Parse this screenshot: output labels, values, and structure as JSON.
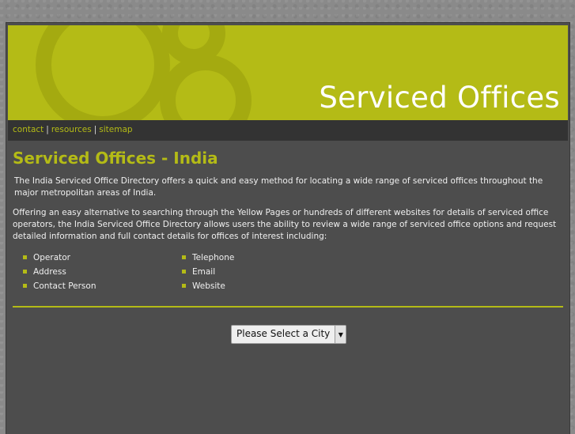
{
  "header": {
    "title": "Serviced Offices",
    "colors": {
      "accent": "#b4bb16",
      "panel": "#4d4d4d",
      "nav": "#333333"
    }
  },
  "nav": {
    "links": [
      {
        "label": "contact"
      },
      {
        "label": "resources"
      },
      {
        "label": "sitemap"
      }
    ],
    "separator": "|"
  },
  "main": {
    "heading": "Serviced Offices - India",
    "intro": "The India Serviced Office Directory offers a quick and easy method for locating a wide range of serviced offices throughout the major metropolitan areas of India.",
    "body": "Offering an easy alternative to searching through the Yellow Pages or hundreds of different websites for details of serviced office operators, the India Serviced Office Directory allows users the ability to review a wide range of serviced office options and request detailed information and full contact details for offices of interest including:",
    "list_left": [
      "Operator",
      "Address",
      "Contact Person"
    ],
    "list_right": [
      "Telephone",
      "Email",
      "Website"
    ]
  },
  "city_select": {
    "selected": "Please Select a City",
    "arrow_icon": "triangle-down-icon"
  }
}
